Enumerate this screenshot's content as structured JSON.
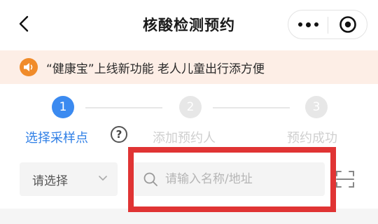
{
  "header": {
    "title": "核酸检测预约",
    "back_icon": "chevron-left-icon",
    "more_icon": "more-dots-icon",
    "close_icon": "target-close-icon"
  },
  "notice": {
    "icon": "speaker-icon",
    "text": "“健康宝”上线新功能 老人儿童出行添方便",
    "bg_color": "#fdeee6",
    "icon_color": "#f08b2a"
  },
  "steps": [
    {
      "number": "1",
      "label": "选择采样点",
      "state": "active"
    },
    {
      "number": "2",
      "label": "添加预约人",
      "state": "pending"
    },
    {
      "number": "3",
      "label": "预约成功",
      "state": "pending"
    }
  ],
  "help_icon_text": "?",
  "filter": {
    "select_value": "请选择",
    "search_placeholder": "请输入名称/地址",
    "scan_icon": "scan-icon"
  },
  "colors": {
    "accent": "#3b8af0",
    "highlight": "#e03434"
  }
}
